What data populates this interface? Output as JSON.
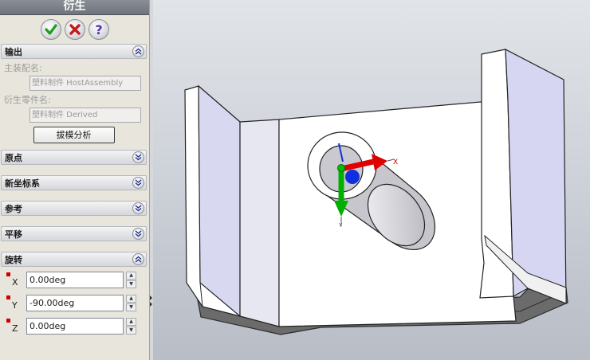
{
  "panel": {
    "title": "衍生",
    "sections": {
      "output": {
        "title": "输出",
        "main_assembly_label": "主装配名:",
        "main_assembly_value": "塑料制件 HostAssembly",
        "derived_part_label": "衍生零件名:",
        "derived_part_value": "塑料制件 Derived",
        "draft_button": "拔模分析"
      },
      "origin": {
        "title": "原点"
      },
      "new_coord": {
        "title": "新坐标系"
      },
      "reference": {
        "title": "参考"
      },
      "translate": {
        "title": "平移"
      },
      "rotate": {
        "title": "旋转",
        "rows": [
          {
            "axis": "X",
            "value": "0.00deg"
          },
          {
            "axis": "Y",
            "value": "-90.00deg"
          },
          {
            "axis": "Z",
            "value": "0.00deg"
          }
        ]
      }
    }
  },
  "viewport": {
    "triad_x_label": "X",
    "triad_y_label": "Y"
  },
  "colors": {
    "ok": "#1f9e1f",
    "cancel": "#c41b1b",
    "help": "#5a2ea6",
    "triad_x": "#e00000",
    "triad_y": "#00b000",
    "triad_z": "#1030e0"
  }
}
